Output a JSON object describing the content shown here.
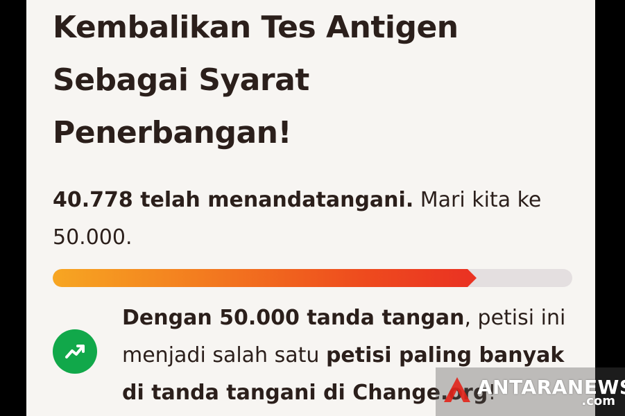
{
  "petition": {
    "title_lines": [
      "Kembalikan Tes Antigen",
      "Sebagai Syarat",
      "Penerbangan!"
    ],
    "signed_bold": "40.778 telah menandatangani.",
    "signed_rest_1": " Mari kita ke",
    "signed_rest_2": "50.000.",
    "progress_fraction": 0.8156
  },
  "info": {
    "line1_bold": "Dengan 50.000 tanda tangan",
    "line1_rest": ", petisi ini",
    "line2_rest": "menjadi salah satu ",
    "line2_bold": "petisi paling banyak",
    "line3_bold": "di tanda tangani di Change.org",
    "line3_rest": "!",
    "icon": "trending-up-icon",
    "icon_color": "#11a84a"
  },
  "watermark": {
    "brand": "ANTARANEWS",
    "suffix": ".com",
    "logo_color": "#e2231a"
  },
  "colors": {
    "background": "#f7f5f2",
    "text": "#2b1f1b",
    "progress_start": "#f7a622",
    "progress_end": "#ea3322",
    "progress_track": "#e4dfe0"
  }
}
